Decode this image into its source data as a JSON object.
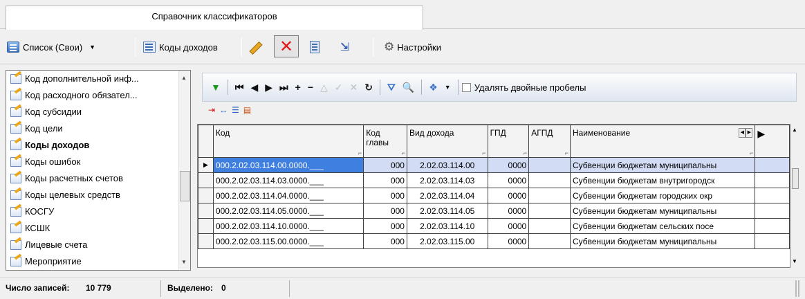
{
  "window": {
    "tab_title": "Справочник классификаторов"
  },
  "toolbar": {
    "list_label": "Список (Свои)",
    "codes_label": "Коды доходов",
    "settings_label": "Настройки"
  },
  "sidebar": {
    "items": [
      {
        "label": "Код дополнительной инф...",
        "active": false
      },
      {
        "label": "Код расходного обязател...",
        "active": false
      },
      {
        "label": "Код субсидии",
        "active": false
      },
      {
        "label": "Код цели",
        "active": false
      },
      {
        "label": "Коды доходов",
        "active": true
      },
      {
        "label": "Коды ошибок",
        "active": false
      },
      {
        "label": "Коды расчетных счетов",
        "active": false
      },
      {
        "label": "Коды целевых средств",
        "active": false
      },
      {
        "label": "КОСГУ",
        "active": false
      },
      {
        "label": "КСШК",
        "active": false
      },
      {
        "label": "Лицевые счета",
        "active": false
      },
      {
        "label": "Мероприятие",
        "active": false
      }
    ]
  },
  "navbar": {
    "checkbox_label": "Удалять двойные пробелы"
  },
  "grid": {
    "columns": [
      "Код",
      "Код главы",
      "Вид дохода",
      "ГПД",
      "АГПД",
      "Наименование"
    ],
    "rows": [
      [
        "000.2.02.03.114.00.0000.___",
        "000",
        "2.02.03.114.00",
        "0000",
        "",
        "Субвенции бюджетам муниципальны"
      ],
      [
        "000.2.02.03.114.03.0000.___",
        "000",
        "2.02.03.114.03",
        "0000",
        "",
        "Субвенции бюджетам внутригородск"
      ],
      [
        "000.2.02.03.114.04.0000.___",
        "000",
        "2.02.03.114.04",
        "0000",
        "",
        "Субвенции бюджетам городских окр"
      ],
      [
        "000.2.02.03.114.05.0000.___",
        "000",
        "2.02.03.114.05",
        "0000",
        "",
        "Субвенции бюджетам муниципальны"
      ],
      [
        "000.2.02.03.114.10.0000.___",
        "000",
        "2.02.03.114.10",
        "0000",
        "",
        "Субвенции бюджетам сельских посе"
      ],
      [
        "000.2.02.03.115.00.0000.___",
        "000",
        "2.02.03.115.00",
        "0000",
        "",
        "Субвенции бюджетам муниципальны"
      ]
    ]
  },
  "status": {
    "records_label": "Число записей:",
    "records_value": "10 779",
    "selected_label": "Выделено:",
    "selected_value": "0"
  },
  "colors": {
    "selection": "#3f7fe0",
    "row_highlight": "#d2dcf4",
    "delete_red": "#e21818"
  }
}
